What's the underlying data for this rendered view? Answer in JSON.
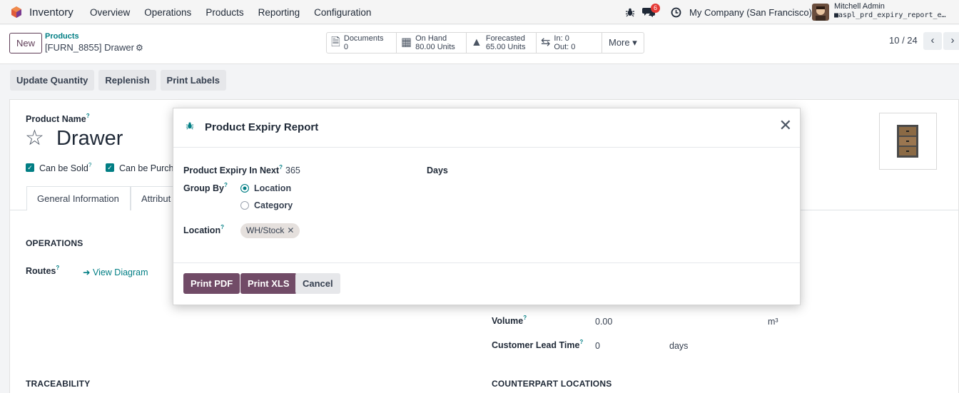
{
  "navbar": {
    "app_name": "Inventory",
    "menu": [
      "Overview",
      "Operations",
      "Products",
      "Reporting",
      "Configuration"
    ],
    "messages_count": "6",
    "company": "My Company (San Francisco)",
    "user_name": "Mitchell Admin",
    "database": "aspl_prd_expiry_report_e…"
  },
  "control": {
    "new_label": "New",
    "breadcrumb_parent": "Products",
    "breadcrumb_current": "[FURN_8855] Drawer",
    "smart_buttons": {
      "documents_label": "Documents",
      "documents_value": "0",
      "onhand_label": "On Hand",
      "onhand_value": "80.00 Units",
      "forecasted_label": "Forecasted",
      "forecasted_value": "65.00 Units",
      "in_label": "In: 0",
      "out_label": "Out: 0",
      "more_label": "More ▾"
    },
    "pager": "10 / 24"
  },
  "actions": [
    "Update Quantity",
    "Replenish",
    "Print Labels"
  ],
  "form": {
    "product_name_label": "Product Name",
    "product_name": "Drawer",
    "can_be_sold": "Can be Sold",
    "can_be_purchased": "Can be Purch",
    "tabs": [
      "General Information",
      "Attribut"
    ],
    "operations_title": "OPERATIONS",
    "routes_label": "Routes",
    "view_diagram": "View Diagram",
    "volume_label": "Volume",
    "volume_value": "0.00",
    "volume_unit": "m³",
    "lead_time_label": "Customer Lead Time",
    "lead_time_value": "0",
    "lead_time_unit": "days",
    "traceability_title": "TRACEABILITY",
    "counterpart_title": "COUNTERPART LOCATIONS"
  },
  "modal": {
    "title": "Product Expiry Report",
    "expiry_label": "Product Expiry In Next",
    "expiry_value": "365",
    "expiry_unit": "Days",
    "group_by_label": "Group By",
    "group_options": [
      "Location",
      "Category"
    ],
    "group_selected": "Location",
    "location_label": "Location",
    "location_tag": "WH/Stock",
    "buttons": {
      "print_pdf": "Print PDF",
      "print_xls": "Print XLS",
      "cancel": "Cancel"
    }
  },
  "colors": {
    "primary": "#714b67",
    "accent": "#017e84"
  }
}
